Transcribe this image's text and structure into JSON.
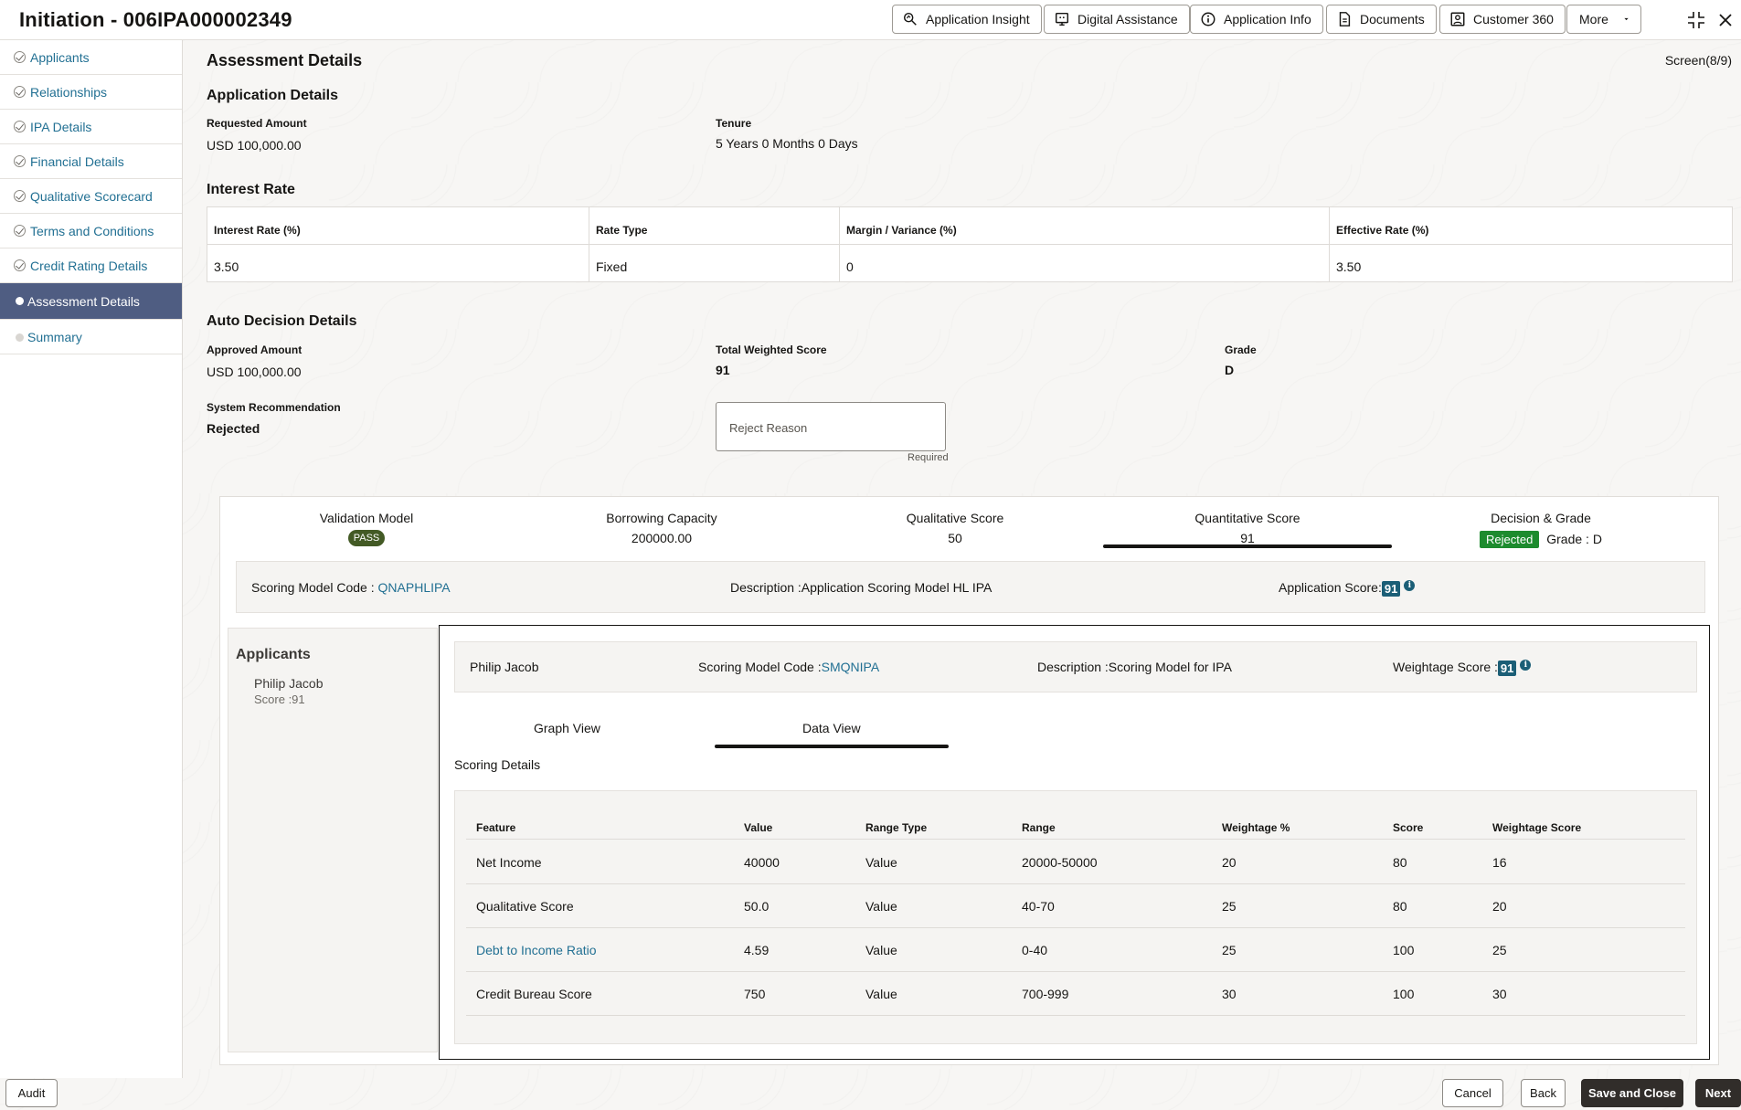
{
  "header": {
    "title": "Initiation - 006IPA000002349",
    "buttons": [
      {
        "label": "Application Insight",
        "icon": "insight-icon"
      },
      {
        "label": "Digital Assistance",
        "icon": "assistant-icon"
      },
      {
        "label": "Application Info",
        "icon": "info-icon"
      },
      {
        "label": "Documents",
        "icon": "document-icon"
      },
      {
        "label": "Customer 360",
        "icon": "customer-icon"
      },
      {
        "label": "More",
        "icon": "chevron-down-icon"
      }
    ]
  },
  "sidebar": {
    "items": [
      {
        "label": "Applicants",
        "state": "done"
      },
      {
        "label": "Relationships",
        "state": "done"
      },
      {
        "label": "IPA Details",
        "state": "done"
      },
      {
        "label": "Financial Details",
        "state": "done"
      },
      {
        "label": "Qualitative Scorecard",
        "state": "done"
      },
      {
        "label": "Terms and Conditions",
        "state": "done"
      },
      {
        "label": "Credit Rating Details",
        "state": "done"
      },
      {
        "label": "Assessment Details",
        "state": "active"
      },
      {
        "label": "Summary",
        "state": "pending"
      }
    ]
  },
  "page": {
    "title": "Assessment Details",
    "screen_indicator": "Screen(8/9)"
  },
  "application_details": {
    "heading": "Application Details",
    "requested_amount_label": "Requested Amount",
    "requested_amount": "USD 100,000.00",
    "tenure_label": "Tenure",
    "tenure": "5 Years 0 Months 0 Days"
  },
  "interest_rate": {
    "heading": "Interest Rate",
    "columns": [
      "Interest Rate (%)",
      "Rate Type",
      "Margin / Variance (%)",
      "Effective Rate (%)"
    ],
    "values": [
      "3.50",
      "Fixed",
      "0",
      "3.50"
    ]
  },
  "auto_decision": {
    "heading": "Auto Decision Details",
    "approved_amount_label": "Approved Amount",
    "approved_amount": "USD 100,000.00",
    "total_weighted_score_label": "Total Weighted Score",
    "total_weighted_score": "91",
    "grade_label": "Grade",
    "grade": "D",
    "system_recommendation_label": "System Recommendation",
    "system_recommendation": "Rejected",
    "reject_reason_placeholder": "Reject Reason",
    "reject_reason_helper": "Required"
  },
  "metrics": {
    "validation_model_label": "Validation Model",
    "validation_model_value": "PASS",
    "borrowing_capacity_label": "Borrowing Capacity",
    "borrowing_capacity_value": "200000.00",
    "qualitative_score_label": "Qualitative Score",
    "qualitative_score_value": "50",
    "quantitative_score_label": "Quantitative Score",
    "quantitative_score_value": "91",
    "decision_grade_label": "Decision & Grade",
    "decision_value": "Rejected",
    "grade_value": "Grade : D"
  },
  "scoring_model": {
    "code_label": "Scoring Model Code : ",
    "code": "QNAPHLIPA",
    "description": "Description :Application Scoring Model HL IPA",
    "app_score_label": "Application Score:",
    "app_score": "91"
  },
  "applicants_panel": {
    "heading": "Applicants",
    "name": "Philip Jacob",
    "score": "Score :91"
  },
  "applicant_detail": {
    "name": "Philip Jacob",
    "code_label": "Scoring Model Code :",
    "code": "SMQNIPA",
    "description": "Description :Scoring Model for IPA",
    "weightage_label": "Weightage Score :",
    "weightage": "91"
  },
  "tabs": {
    "graph": "Graph View",
    "data": "Data View",
    "active": "Data View"
  },
  "scoring_details": {
    "heading": "Scoring Details",
    "columns": [
      "Feature",
      "Value",
      "Range Type",
      "Range",
      "Weightage %",
      "Score",
      "Weightage Score"
    ],
    "rows": [
      [
        "Net Income",
        "40000",
        "Value",
        "20000-50000",
        "20",
        "80",
        "16"
      ],
      [
        "Qualitative Score",
        "50.0",
        "Value",
        "40-70",
        "25",
        "80",
        "20"
      ],
      [
        "Debt to Income Ratio",
        "4.59",
        "Value",
        "0-40",
        "25",
        "100",
        "25"
      ],
      [
        "Credit Bureau Score",
        "750",
        "Value",
        "700-999",
        "30",
        "100",
        "30"
      ]
    ]
  },
  "footer": {
    "audit": "Audit",
    "cancel": "Cancel",
    "back": "Back",
    "save_close": "Save and Close",
    "next": "Next"
  },
  "colors": {
    "link": "#227093",
    "active_nav": "#4f5d82",
    "pass_badge": "#435a25",
    "rejected_badge": "#1d8b2e",
    "score_chip": "#1b5e76"
  }
}
